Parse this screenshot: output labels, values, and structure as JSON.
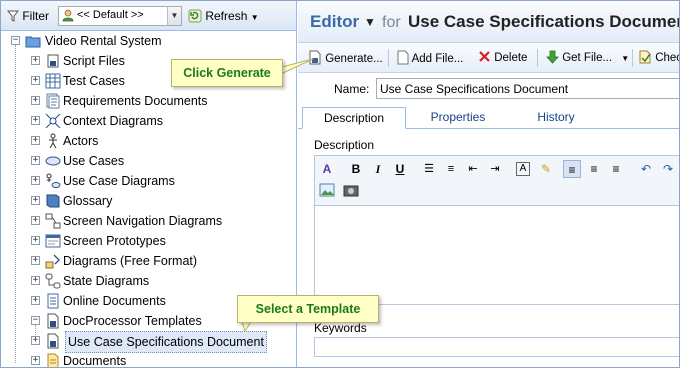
{
  "toolbar": {
    "filter_label": "Filter",
    "filter_value": "<< Default >>",
    "refresh_label": "Refresh"
  },
  "tree": {
    "root": "Video Rental System",
    "items": [
      {
        "label": "Script Files",
        "icon": "script-file-icon"
      },
      {
        "label": "Test Cases",
        "icon": "test-grid-icon"
      },
      {
        "label": "Requirements Documents",
        "icon": "requirements-icon"
      },
      {
        "label": "Context Diagrams",
        "icon": "context-diagram-icon"
      },
      {
        "label": "Actors",
        "icon": "actor-icon"
      },
      {
        "label": "Use Cases",
        "icon": "use-case-ellipse-icon"
      },
      {
        "label": "Use Case Diagrams",
        "icon": "use-case-diagram-icon"
      },
      {
        "label": "Glossary",
        "icon": "glossary-book-icon"
      },
      {
        "label": "Screen Navigation Diagrams",
        "icon": "navigation-diagram-icon"
      },
      {
        "label": "Screen Prototypes",
        "icon": "prototype-window-icon"
      },
      {
        "label": "Diagrams (Free Format)",
        "icon": "free-diagram-icon"
      },
      {
        "label": "State Diagrams",
        "icon": "state-diagram-icon"
      },
      {
        "label": "Online Documents",
        "icon": "online-document-icon"
      },
      {
        "label": "DocProcessor Templates",
        "icon": "template-file-icon"
      },
      {
        "label": "Use Case Specifications Document",
        "icon": "template-file-icon"
      },
      {
        "label": "Documents",
        "icon": "document-icon"
      }
    ]
  },
  "editor": {
    "title": "Editor",
    "for_label": "for",
    "doc_title": "Use Case Specifications Document",
    "actions": {
      "generate": "Generate...",
      "add_file": "Add File...",
      "delete": "Delete",
      "get_file": "Get File...",
      "check": "Chec"
    },
    "name_label": "Name:",
    "name_value": "Use Case Specifications Document",
    "tabs": [
      "Description",
      "Properties",
      "History"
    ],
    "description_label": "Description",
    "keywords_label": "Keywords"
  },
  "callouts": {
    "generate": "Click Generate",
    "template": "Select a Template"
  },
  "colors": {
    "title_blue": "#3a6aa6",
    "callout_bg": "#ffffc6",
    "callout_text": "#1c7a1c",
    "panel_border": "#99bbe8"
  }
}
